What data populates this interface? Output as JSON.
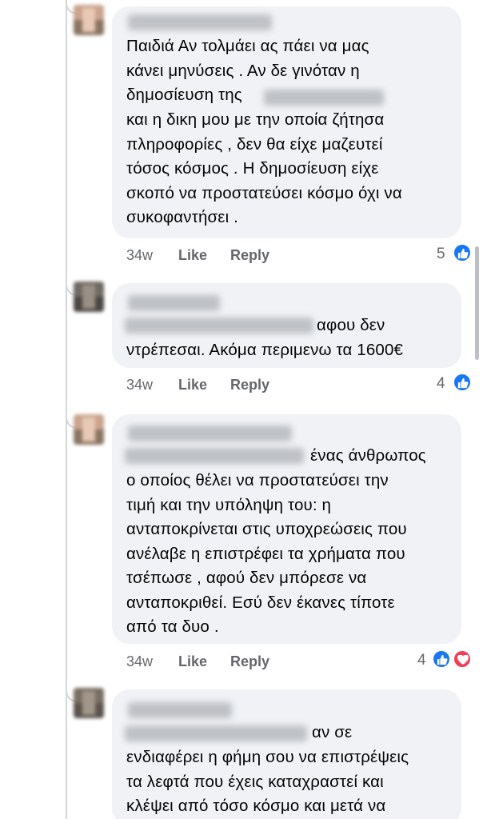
{
  "comments": [
    {
      "text": "Παιδιά Αν τολμάει ας πάει να μας\nκάνει μηνύσεις . Αν δε γινόταν η\nδημοσίευση της",
      "text_rest": "και η δικη μου με την οποία ζήτησα\nπληροφορίες , δεν θα είχε μαζευτεί\nτόσος κόσμος . Η δημοσίευση είχε\nσκοπό να προστατεύσει κόσμο  όχι να\nσυκοφαντήσει .",
      "time": "34w",
      "like": "Like",
      "reply": "Reply",
      "reactions": "5"
    },
    {
      "text_inline": "αφου δεν",
      "text_rest": "ντρέπεσαι. Ακόμα περιμενω τα 1600€",
      "time": "34w",
      "like": "Like",
      "reply": "Reply",
      "reactions": "4"
    },
    {
      "text_inline": "ένας άνθρωπος",
      "text_rest": "ο οποίος θέλει να προστατεύσει την\nτιμή και την υπόληψη του: η\nανταποκρίνεται στις υποχρεώσεις που\nανέλαβε η επιστρέφει τα χρήματα που\nτσέπωσε , αφού δεν μπόρεσε να\nανταποκριθεί. Εσύ δεν έκανες τίποτε\nαπό τα δυο .",
      "time": "34w",
      "like": "Like",
      "reply": "Reply",
      "reactions": "4"
    },
    {
      "text_inline": "αν σε",
      "text_rest": "ενδιαφέρει η φήμη σου να επιστρέψεις\nτα λεφτά που έχεις καταχραστεί και\nκλέψει από τόσο κόσμο και μετά να"
    }
  ],
  "icons": {
    "like": "like-thumb-icon",
    "love": "love-heart-icon"
  },
  "colors": {
    "bubble": "#f0f2f5",
    "like_blue": "#1877f2",
    "love_red": "#f33e58",
    "meta_gray": "#65676b"
  }
}
